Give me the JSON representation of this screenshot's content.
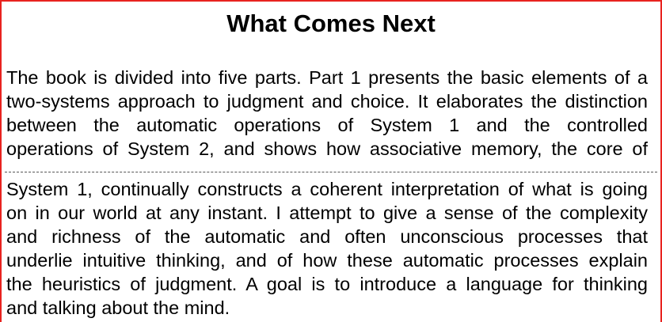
{
  "title": "What Comes Next",
  "lines_top": [
    "The book is divided into five parts. Part 1 presents the basic elements of a",
    "two-systems approach to judgment and choice. It elaborates the distinction",
    "between the automatic operations of System 1 and the controlled",
    "operations of System 2, and shows how associative memory, the core of"
  ],
  "lines_bottom": [
    "System 1, continually constructs a coherent interpretation of what is going",
    "on in our world at any instant. I attempt to give a sense of the complexity",
    "and richness of the automatic and often unconscious processes that",
    "underlie intuitive thinking, and of how these automatic processes explain",
    "the heuristics of judgment. A goal is to introduce a language for thinking",
    "and talking about the mind."
  ],
  "colors": {
    "frame_border": "#e8231f",
    "text": "#000000",
    "divider": "#555555"
  }
}
